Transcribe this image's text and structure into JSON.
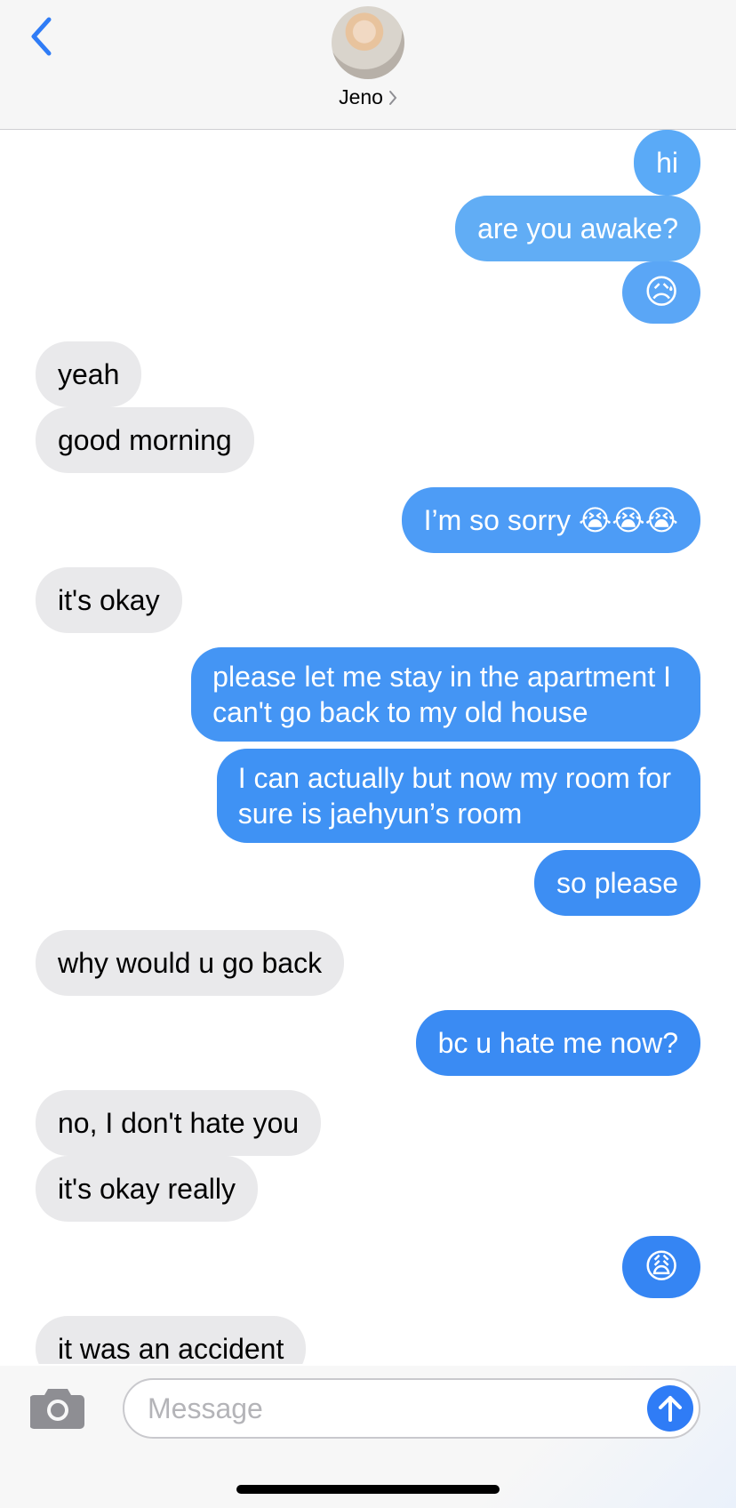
{
  "header": {
    "contact_name": "Jeno",
    "back_icon": "chevron-left-icon",
    "avatar": "contact-avatar"
  },
  "messages": [
    {
      "dir": "out",
      "text": "hi",
      "color": "#5aaaf7"
    },
    {
      "dir": "out",
      "text": "are you awake?",
      "color": "#61adf5"
    },
    {
      "dir": "out",
      "text": "😥",
      "color": "#5aa6f6",
      "emoji": true
    },
    {
      "dir": "in",
      "text": "yeah"
    },
    {
      "dir": "in",
      "text": "good morning"
    },
    {
      "dir": "out",
      "text": "I’m so sorry 😭😭😭",
      "color": "#4d9cf6"
    },
    {
      "dir": "in",
      "text": "it's okay"
    },
    {
      "dir": "out",
      "text": "please let me stay in the apartment I can't go back to my old house",
      "lines": [
        "please let me stay in the apartment I",
        "can't go back to my old house"
      ],
      "color": "#4495f4"
    },
    {
      "dir": "out",
      "text": "I can actually but now my room for sure is jaehyun’s room",
      "lines": [
        "I can actually but now my room for",
        "sure is jaehyun’s room"
      ],
      "color": "#3f92f4"
    },
    {
      "dir": "out",
      "text": "so please",
      "color": "#3d8ef3"
    },
    {
      "dir": "in",
      "text": "why would u go back"
    },
    {
      "dir": "out",
      "text": "bc u hate me now?",
      "color": "#3a8bf3"
    },
    {
      "dir": "in",
      "text": "no, I don't hate you"
    },
    {
      "dir": "in",
      "text": "it's okay really"
    },
    {
      "dir": "out",
      "text": "😩",
      "color": "#3585f3",
      "emoji": true
    },
    {
      "dir": "in",
      "text": "it was an accident"
    }
  ],
  "input": {
    "placeholder": "Message",
    "camera_icon": "camera-icon",
    "send_icon": "arrow-up-icon"
  },
  "colors": {
    "accent": "#2f7cf6",
    "incoming_bubble": "#e9e9eb"
  }
}
